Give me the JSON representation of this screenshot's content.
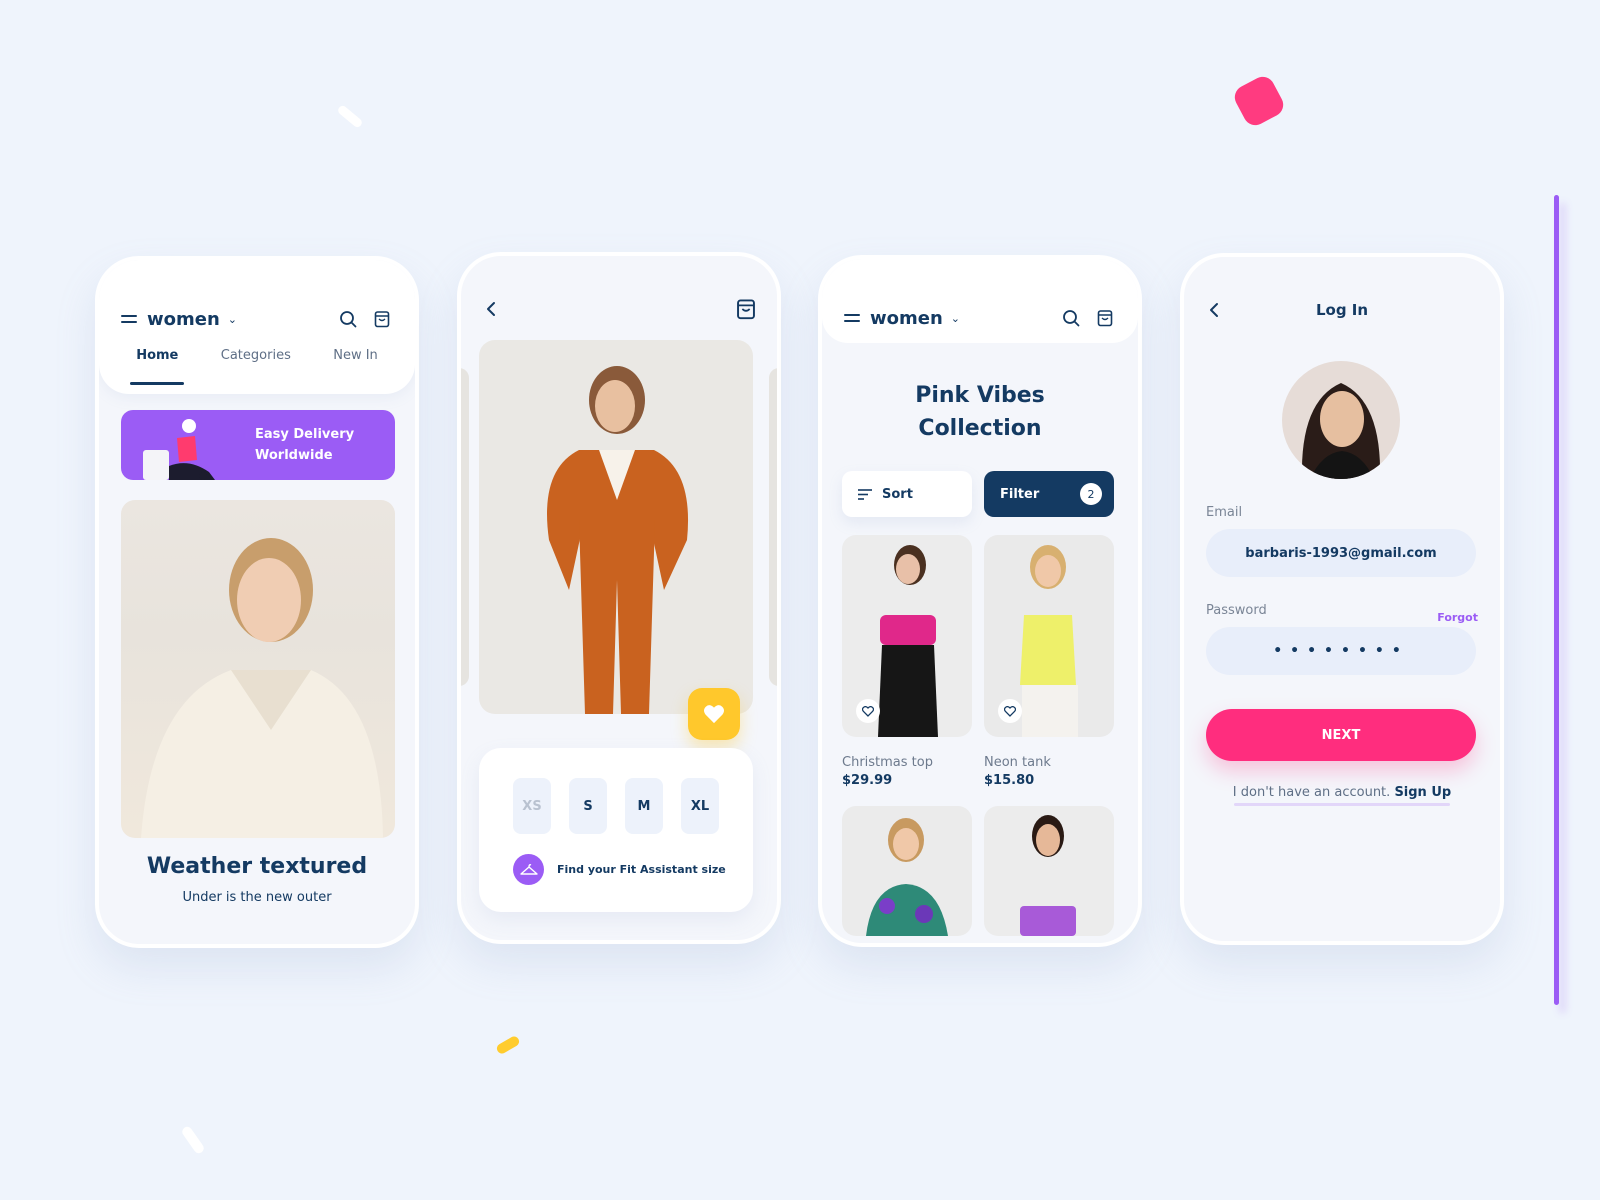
{
  "colors": {
    "background": "#eff4fc",
    "navy": "#143a62",
    "purple": "#9b5cf5",
    "pink": "#ff2d7e",
    "yellow": "#ffc82c"
  },
  "screen_home": {
    "header": {
      "menu_icon": "hamburger-icon",
      "category": "women",
      "dropdown_icon": "chevron-down-icon",
      "search_icon": "search-icon",
      "bag_icon": "shopping-bag-icon"
    },
    "tabs": [
      {
        "label": "Home",
        "active": true
      },
      {
        "label": "Categories",
        "active": false
      },
      {
        "label": "New In",
        "active": false
      }
    ],
    "banner": {
      "line1": "Easy Delivery",
      "line2": "Worldwide"
    },
    "hero": {
      "title": "Weather textured",
      "subtitle": "Under is the new outer"
    }
  },
  "screen_product": {
    "back_icon": "chevron-left-icon",
    "bag_icon": "shopping-bag-icon",
    "favorite_icon": "heart-icon",
    "sizes": [
      {
        "label": "XS",
        "available": false
      },
      {
        "label": "S",
        "available": true
      },
      {
        "label": "M",
        "available": true
      },
      {
        "label": "XL",
        "available": true
      }
    ],
    "fit_assistant": {
      "icon": "hanger-icon",
      "label": "Find your Fit Assistant size"
    }
  },
  "screen_collection": {
    "header": {
      "category": "women"
    },
    "title_line1": "Pink Vibes",
    "title_line2": "Collection",
    "sort_label": "Sort",
    "filter_label": "Filter",
    "filter_count": "2",
    "products": [
      {
        "name": "Christmas top",
        "price": "$29.99"
      },
      {
        "name": "Neon tank",
        "price": "$15.80"
      },
      {
        "name": "",
        "price": ""
      },
      {
        "name": "",
        "price": ""
      }
    ]
  },
  "screen_login": {
    "title": "Log In",
    "email_label": "Email",
    "email_value": "barbaris-1993@gmail.com",
    "password_label": "Password",
    "forgot_label": "Forgot",
    "password_value": "••••••••",
    "next_label": "NEXT",
    "no_account_text": "I don't have an account.",
    "signup_label": "Sign Up"
  }
}
